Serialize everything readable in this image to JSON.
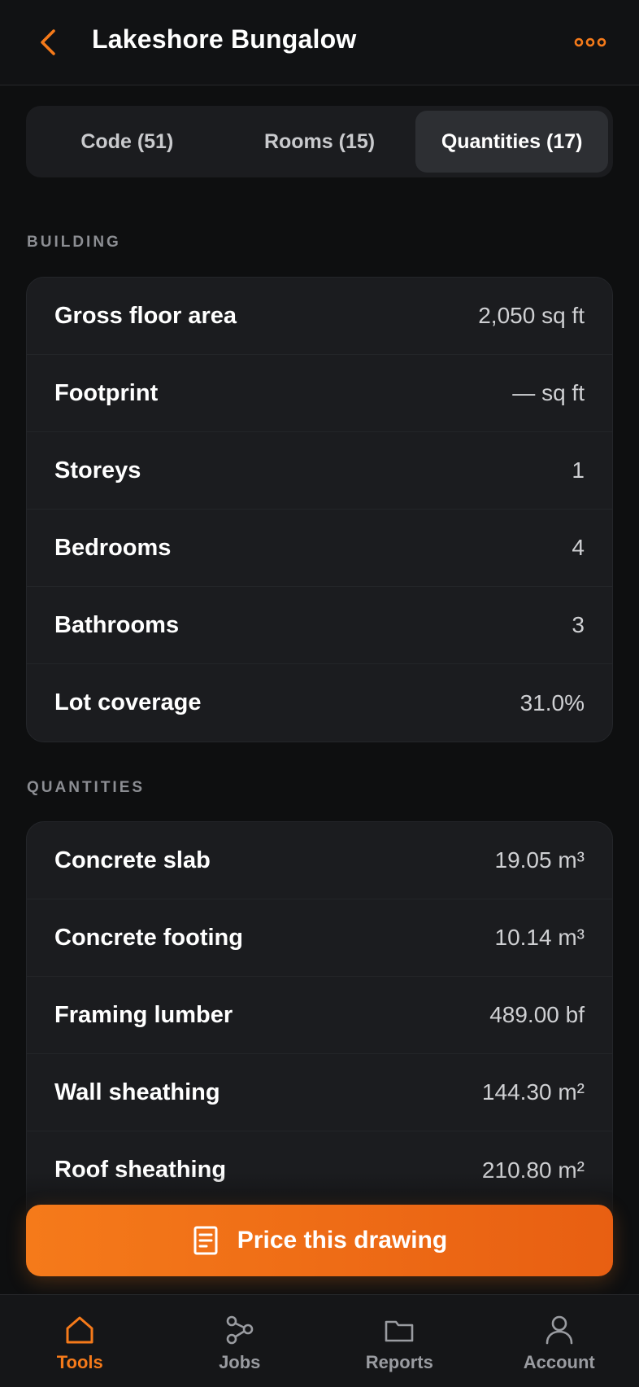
{
  "header": {
    "title": "Lakeshore Bungalow",
    "back_icon": "chevron-left-icon",
    "more_icon": "more-horizontal-icon",
    "accent_color": "#f57a1a"
  },
  "tabs": [
    {
      "label": "Code (51)",
      "active": false
    },
    {
      "label": "Rooms (15)",
      "active": false
    },
    {
      "label": "Quantities (17)",
      "active": true
    }
  ],
  "building": {
    "section_label": "BUILDING",
    "rows": [
      {
        "label": "Gross floor area",
        "value": "2,050 sq ft"
      },
      {
        "label": "Footprint",
        "value": "— sq ft"
      },
      {
        "label": "Storeys",
        "value": "1"
      },
      {
        "label": "Bedrooms",
        "value": "4"
      },
      {
        "label": "Bathrooms",
        "value": "3"
      },
      {
        "label": "Lot coverage",
        "value": "31.0%"
      }
    ]
  },
  "quantities": {
    "section_label": "QUANTITIES",
    "rows": [
      {
        "label": "Concrete slab",
        "value": "19.05 m³"
      },
      {
        "label": "Concrete footing",
        "value": "10.14 m³"
      },
      {
        "label": "Framing lumber",
        "value": "489.00 bf"
      },
      {
        "label": "Wall sheathing",
        "value": "144.30 m²"
      },
      {
        "label": "Roof sheathing",
        "value": "210.80 m²"
      }
    ]
  },
  "cta": {
    "label": "Price this drawing",
    "icon": "document-icon"
  },
  "tabbar": [
    {
      "label": "Tools",
      "icon": "home-icon",
      "active": true
    },
    {
      "label": "Jobs",
      "icon": "workflow-icon",
      "active": false
    },
    {
      "label": "Reports",
      "icon": "folder-icon",
      "active": false
    },
    {
      "label": "Account",
      "icon": "user-icon",
      "active": false
    }
  ]
}
